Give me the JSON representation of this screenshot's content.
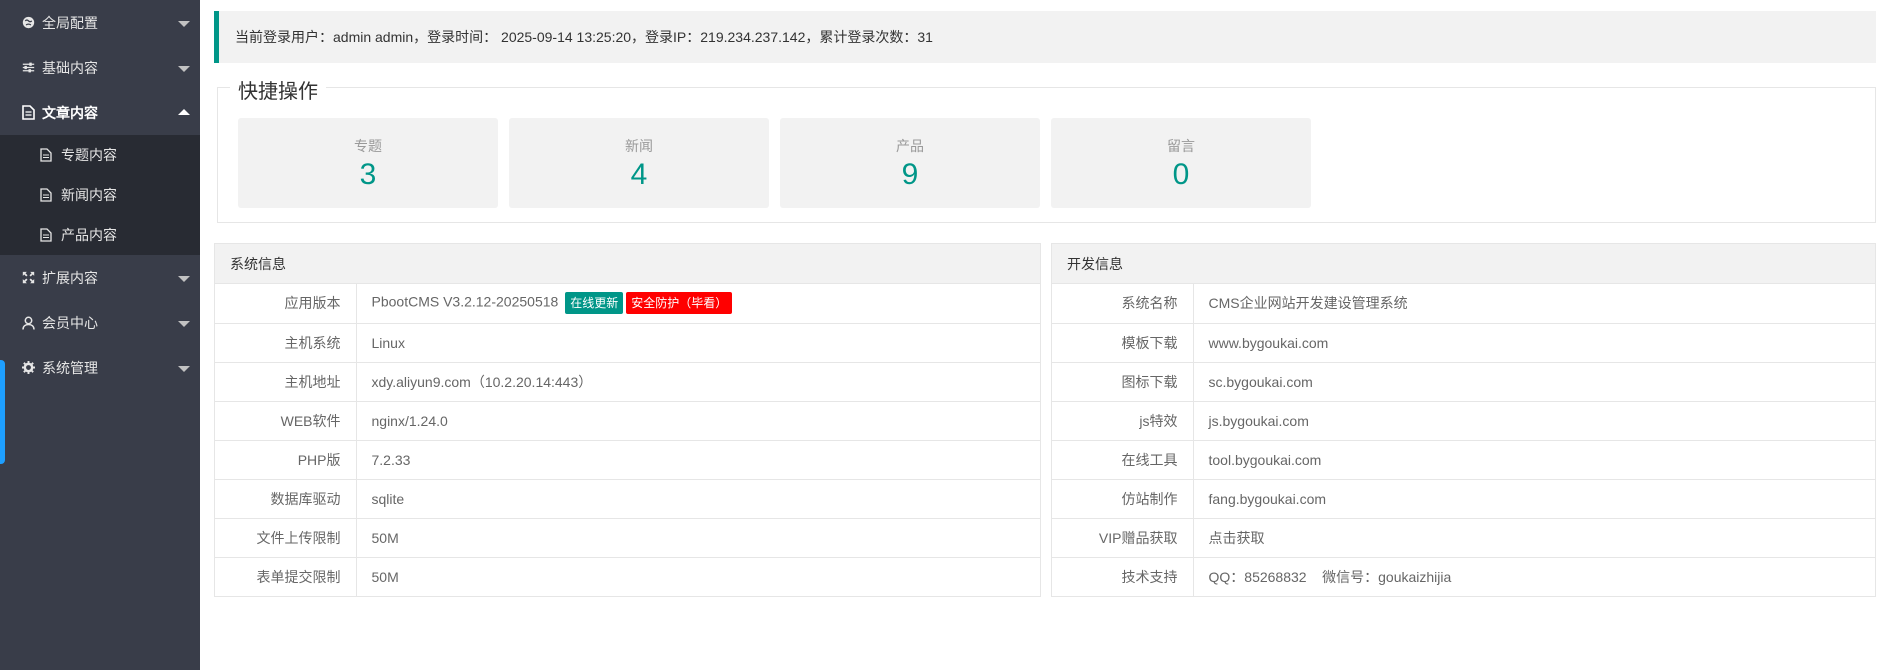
{
  "sidebar": {
    "items": [
      {
        "label": "全局配置",
        "icon": "globe-icon"
      },
      {
        "label": "基础内容",
        "icon": "sliders-icon"
      },
      {
        "label": "文章内容",
        "icon": "document-icon",
        "children": [
          {
            "label": "专题内容",
            "icon": "file-icon"
          },
          {
            "label": "新闻内容",
            "icon": "file-icon"
          },
          {
            "label": "产品内容",
            "icon": "file-icon"
          }
        ]
      },
      {
        "label": "扩展内容",
        "icon": "expand-icon"
      },
      {
        "label": "会员中心",
        "icon": "user-icon"
      },
      {
        "label": "系统管理",
        "icon": "gear-icon"
      }
    ]
  },
  "login_info": "当前登录用户：admin admin，登录时间： 2025-09-14 13:25:20，登录IP：219.234.237.142，累计登录次数：31",
  "quick": {
    "title": "快捷操作",
    "cards": [
      {
        "label": "专题",
        "count": "3"
      },
      {
        "label": "新闻",
        "count": "4"
      },
      {
        "label": "产品",
        "count": "9"
      },
      {
        "label": "留言",
        "count": "0"
      }
    ]
  },
  "system_info": {
    "title": "系统信息",
    "rows": [
      {
        "key": "应用版本",
        "value": "PbootCMS V3.2.12-20250518"
      },
      {
        "key": "主机系统",
        "value": "Linux"
      },
      {
        "key": "主机地址",
        "value": "xdy.aliyun9.com（10.2.20.14:443）"
      },
      {
        "key": "WEB软件",
        "value": "nginx/1.24.0"
      },
      {
        "key": "PHP版",
        "value": "7.2.33"
      },
      {
        "key": "数据库驱动",
        "value": "sqlite"
      },
      {
        "key": "文件上传限制",
        "value": "50M"
      },
      {
        "key": "表单提交限制",
        "value": "50M"
      }
    ],
    "update_badge": "在线更新",
    "security_badge": "安全防护（毕看）"
  },
  "dev_info": {
    "title": "开发信息",
    "rows": [
      {
        "key": "系统名称",
        "value": "CMS企业网站开发建设管理系统"
      },
      {
        "key": "模板下载",
        "value": "www.bygoukai.com"
      },
      {
        "key": "图标下载",
        "value": "sc.bygoukai.com"
      },
      {
        "key": "js特效",
        "value": "js.bygoukai.com"
      },
      {
        "key": "在线工具",
        "value": "tool.bygoukai.com"
      },
      {
        "key": "仿站制作",
        "value": "fang.bygoukai.com"
      },
      {
        "key": "VIP赠品获取",
        "value": "点击获取"
      },
      {
        "key": "技术支持",
        "value": "QQ：85268832    微信号：goukaizhijia"
      }
    ]
  },
  "colors": {
    "sidebar": "#393D49",
    "sidebar_sub": "#282B33",
    "accent": "#009688",
    "danger": "#FF0000",
    "edge_tab": "#1E9FFF"
  }
}
